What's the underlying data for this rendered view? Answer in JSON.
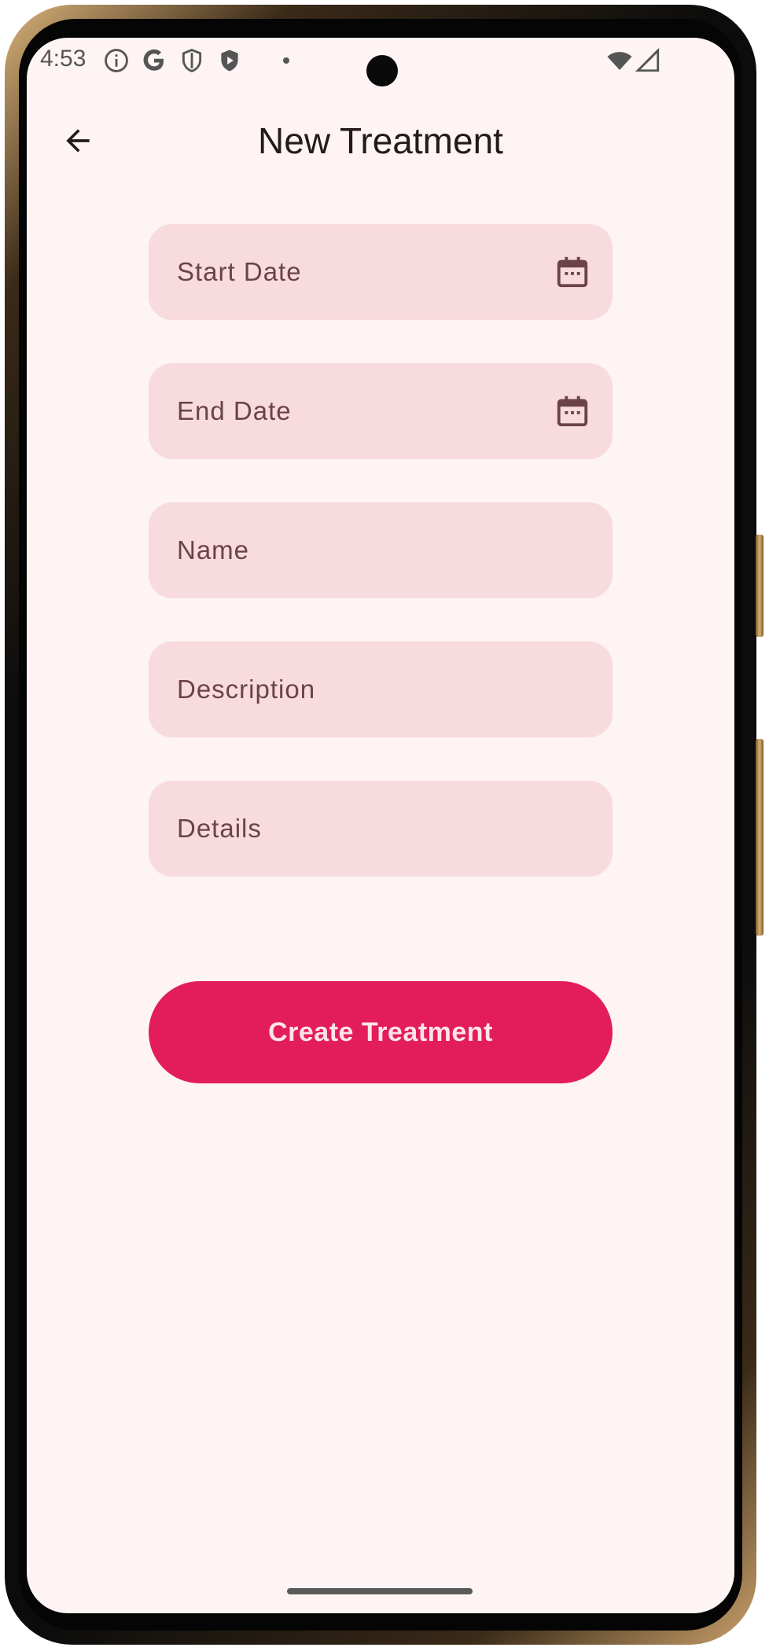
{
  "status_bar": {
    "time": "4:53",
    "left_icons": [
      "info-icon",
      "google-icon",
      "shield-icon",
      "play-shield-icon",
      "dot-icon"
    ],
    "right_icons": [
      "wifi-icon",
      "signal-icon"
    ]
  },
  "app_bar": {
    "back_icon": "arrow-back-icon",
    "title": "New Treatment"
  },
  "form": {
    "start_date_label": "Start Date",
    "end_date_label": "End Date",
    "name_label": "Name",
    "description_label": "Description",
    "details_label": "Details",
    "date_icon": "calendar-icon"
  },
  "actions": {
    "create_label": "Create Treatment"
  },
  "colors": {
    "background": "#fdf4f3",
    "field_fill": "#f8dbde",
    "label_text": "#6b4248",
    "accent": "#e31d5c",
    "button_text": "#ffe4ea"
  }
}
